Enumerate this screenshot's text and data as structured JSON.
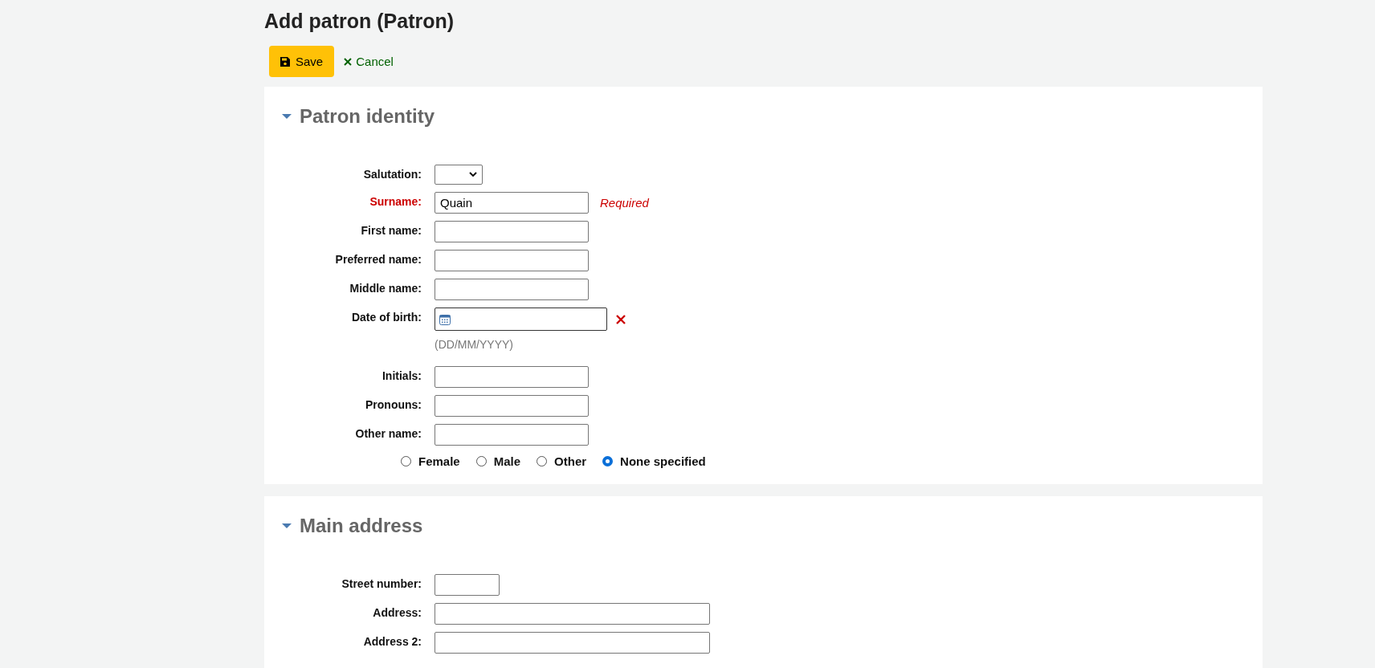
{
  "page_title": "Add patron (Patron)",
  "toolbar": {
    "save": "Save",
    "cancel": "Cancel"
  },
  "sections": [
    {
      "title": "Patron identity",
      "expanded": true,
      "fields": [
        {
          "kind": "select",
          "label": "Salutation:",
          "required": false
        },
        {
          "kind": "text",
          "label": "Surname:",
          "value": "Quain",
          "required": true,
          "note": "Required"
        },
        {
          "kind": "text",
          "label": "First name:",
          "required": false
        },
        {
          "kind": "text",
          "label": "Preferred name:",
          "required": false
        },
        {
          "kind": "text",
          "label": "Middle name:",
          "required": false
        },
        {
          "kind": "date",
          "label": "Date of birth:",
          "required": false,
          "hint": "(DD/MM/YYYY)"
        },
        {
          "kind": "text",
          "label": "Initials:",
          "required": false
        },
        {
          "kind": "text",
          "label": "Pronouns:",
          "required": false
        },
        {
          "kind": "text",
          "label": "Other name:",
          "required": false
        }
      ],
      "gender": [
        {
          "label": "Female",
          "selected": false
        },
        {
          "label": "Male",
          "selected": false
        },
        {
          "label": "Other",
          "selected": false
        },
        {
          "label": "None specified",
          "selected": true
        }
      ]
    },
    {
      "title": "Main address",
      "expanded": true,
      "fields": [
        {
          "kind": "short",
          "label": "Street number:",
          "required": false
        },
        {
          "kind": "long",
          "label": "Address:",
          "required": false
        },
        {
          "kind": "long",
          "label": "Address 2:",
          "required": false
        }
      ]
    }
  ]
}
